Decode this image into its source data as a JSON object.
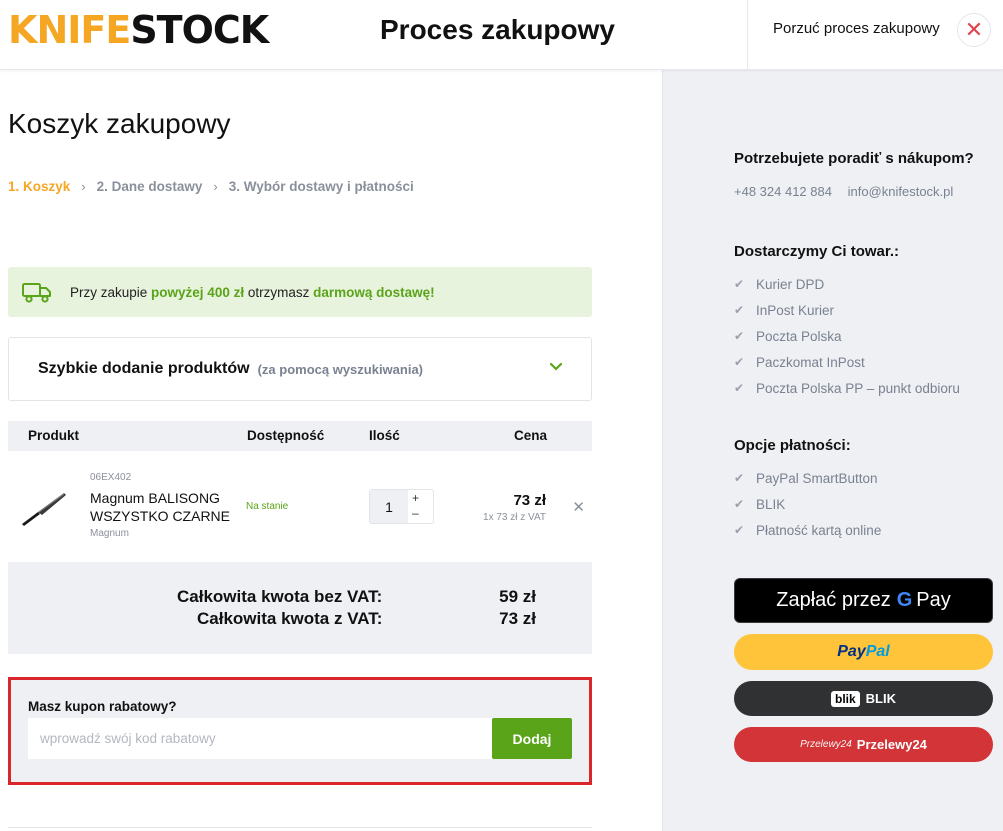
{
  "header": {
    "logo_part1": "KNIFE",
    "logo_part2": "STOCK",
    "title": "Proces zakupowy",
    "abandon_label": "Porzuć proces zakupowy"
  },
  "main": {
    "page_title": "Koszyk zakupowy",
    "steps": [
      {
        "label": "1.  Koszyk",
        "active": true
      },
      {
        "label": "2.  Dane dostawy",
        "active": false
      },
      {
        "label": "3.  Wybór dostawy i płatności",
        "active": false
      }
    ],
    "free_shipping": {
      "text_1": "Przy zakupie ",
      "highlight_1": "powyżej 400 zł",
      "text_2": " otrzymasz ",
      "highlight_2": "darmową dostawę!"
    },
    "quick_add": {
      "title": "Szybkie dodanie produktów",
      "hint": "(za pomocą wyszukiwania)"
    },
    "cart_columns": {
      "product": "Produkt",
      "availability": "Dostępność",
      "quantity": "Ilość",
      "price": "Cena"
    },
    "cart_items": [
      {
        "sku": "06EX402",
        "name_line1": "Magnum BALISONG",
        "name_line2": "WSZYSTKO CZARNE",
        "brand": "Magnum",
        "availability": "Na stanie",
        "quantity": "1",
        "price": "73 zł",
        "unit_price": "1x 73 zł z VAT"
      }
    ],
    "totals": {
      "net_label": "Całkowita kwota bez VAT:",
      "net_value": "59 zł",
      "gross_label": "Całkowita kwota z VAT:",
      "gross_value": "73 zł"
    },
    "coupon": {
      "label": "Masz kupon rabatowy?",
      "placeholder": "wprowadź swój kod rabatowy",
      "value": "",
      "button": "Dodaj"
    }
  },
  "sidebar": {
    "help_heading": "Potrzebujete poradiť s nákupom?",
    "phone": "+48 324 412 884",
    "email": "info@knifestock.pl",
    "delivery_heading": "Dostarczymy Ci towar.:",
    "delivery_options": [
      "Kurier DPD",
      "InPost Kurier",
      "Poczta Polska",
      "Paczkomat InPost",
      "Poczta Polska PP – punkt odbioru"
    ],
    "payment_heading": "Opcje płatności:",
    "payment_options": [
      "PayPal SmartButton",
      "BLIK",
      "Płatność kartą online"
    ],
    "buttons": {
      "gpay_text": "Zapłać przez",
      "gpay_g": "G",
      "gpay_pay": "Pay",
      "paypal_pay": "Pay",
      "paypal_pal": "Pal",
      "blik_logo": "blik",
      "blik_label": "BLIK",
      "p24_logo": "Przelewy24",
      "p24_label": "Przelewy24"
    }
  },
  "colors": {
    "accent_orange": "#f5a623",
    "accent_green": "#5aa41a",
    "highlight_red": "#d9262b",
    "sidebar_bg": "#eef0f4"
  }
}
